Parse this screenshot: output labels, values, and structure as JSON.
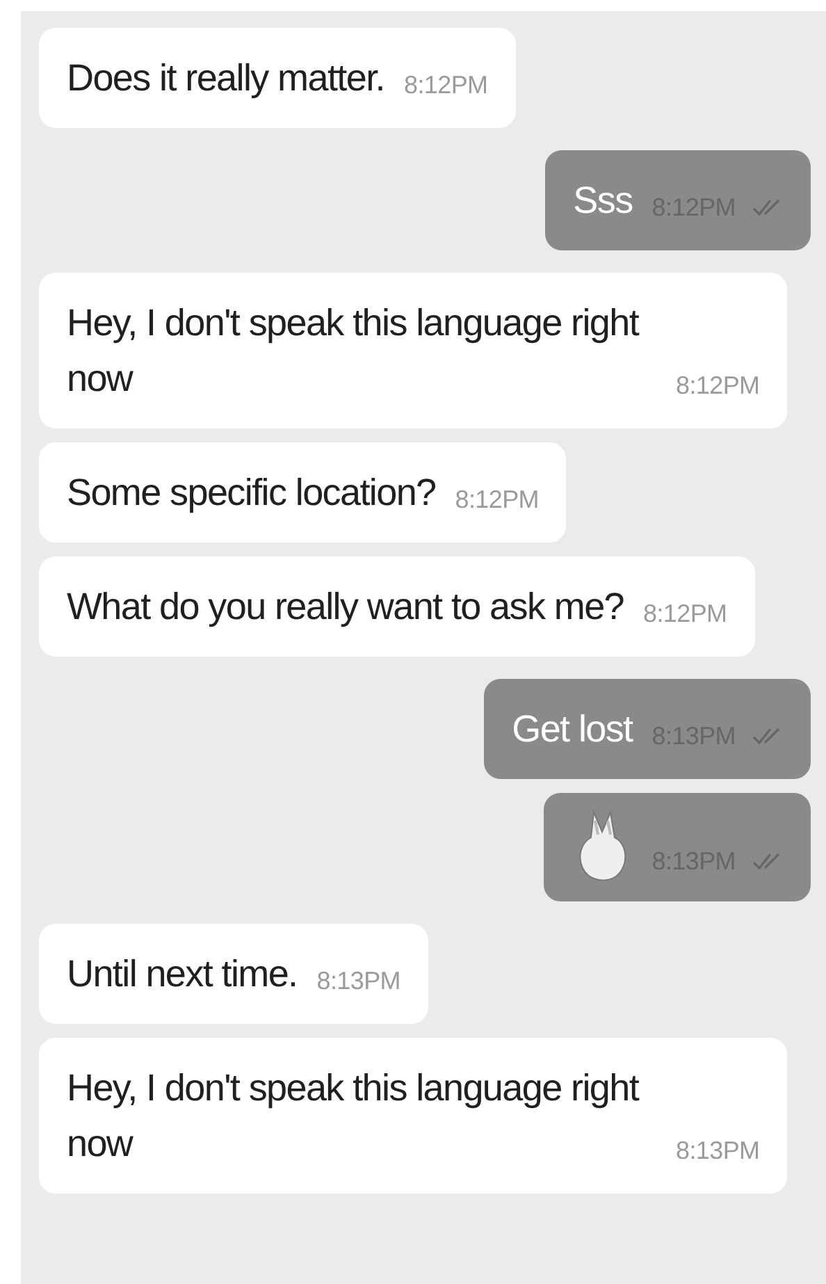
{
  "messages": [
    {
      "kind": "incoming",
      "text": "Does it really matter.",
      "time": "8:12PM"
    },
    {
      "kind": "outgoing",
      "text": "Sss",
      "time": "8:12PM",
      "read": true
    },
    {
      "kind": "incoming",
      "text": "Hey, I don't speak this language right now",
      "time": "8:12PM"
    },
    {
      "kind": "incoming",
      "text": "Some specific location?",
      "time": "8:12PM"
    },
    {
      "kind": "incoming",
      "text": "What do you really want to ask me?",
      "time": "8:12PM"
    },
    {
      "kind": "outgoing",
      "text": "Get lost",
      "time": "8:13PM",
      "read": true
    },
    {
      "kind": "sticker",
      "time": "8:13PM",
      "read": true
    },
    {
      "kind": "incoming",
      "text": "Until next time.",
      "time": "8:13PM"
    },
    {
      "kind": "incoming",
      "text": "Hey, I don't speak this language right now",
      "time": "8:13PM"
    }
  ]
}
